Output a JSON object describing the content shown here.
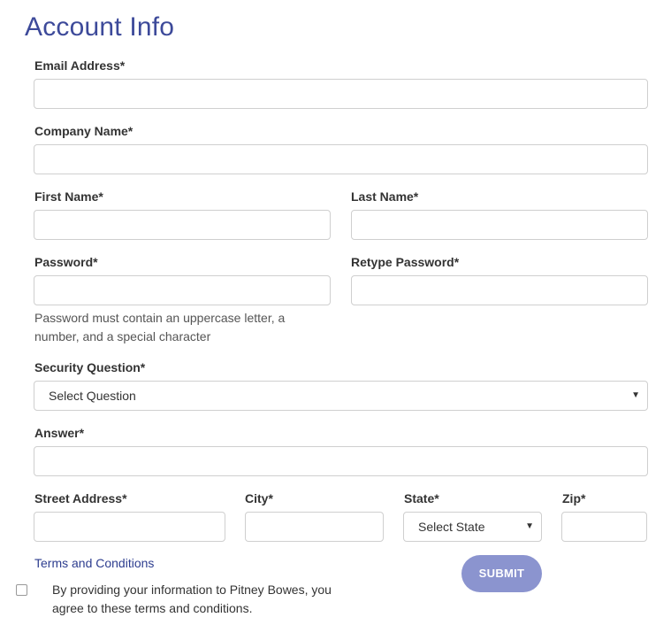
{
  "title": "Account Info",
  "fields": {
    "email": {
      "label": "Email Address*",
      "value": ""
    },
    "company": {
      "label": "Company Name*",
      "value": ""
    },
    "first_name": {
      "label": "First Name*",
      "value": ""
    },
    "last_name": {
      "label": "Last Name*",
      "value": ""
    },
    "password": {
      "label": "Password*",
      "value": ""
    },
    "retype_password": {
      "label": "Retype Password*",
      "value": ""
    },
    "password_hint": "Password must contain an uppercase letter, a number, and a special character",
    "security_question": {
      "label": "Security Question*",
      "selected": "Select Question"
    },
    "answer": {
      "label": "Answer*",
      "value": ""
    },
    "street": {
      "label": "Street Address*",
      "value": ""
    },
    "city": {
      "label": "City*",
      "value": ""
    },
    "state": {
      "label": "State*",
      "selected": "Select State"
    },
    "zip": {
      "label": "Zip*",
      "value": ""
    }
  },
  "terms_link": "Terms and Conditions",
  "consent_text": "By providing your information to Pitney Bowes, you agree to these terms and conditions.",
  "submit_label": "SUBMIT",
  "colors": {
    "title": "#3d4a9a",
    "link": "#2d3d8f",
    "submit_bg": "#8b94cf"
  }
}
